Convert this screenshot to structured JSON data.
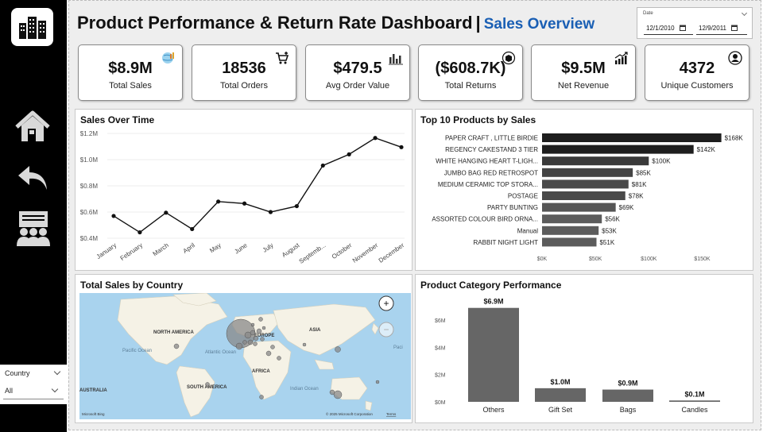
{
  "nav": {
    "logo_icon": "building-icon",
    "items": [
      {
        "icon": "home-icon",
        "name": "home"
      },
      {
        "icon": "back-arrow-icon",
        "name": "back"
      },
      {
        "icon": "team-presentation-icon",
        "name": "customers"
      }
    ]
  },
  "slicer": {
    "title": "Country",
    "value": "All"
  },
  "header": {
    "title": "Product Performance & Return Rate Dashboard",
    "separator": "|",
    "subtitle": "Sales Overview"
  },
  "date_filter": {
    "label": "Date",
    "start": "12/1/2010",
    "end": "12/9/2011"
  },
  "kpis": [
    {
      "value": "$8.9M",
      "label": "Total Sales",
      "icon": "globe-chart-icon"
    },
    {
      "value": "18536",
      "label": "Total Orders",
      "icon": "shopping-cart-icon"
    },
    {
      "value": "$479.5",
      "label": "Avg Order Value",
      "icon": "bar-chart-icon"
    },
    {
      "value": "($608.7K)",
      "label": "Total Returns",
      "icon": "return-box-icon"
    },
    {
      "value": "$9.5M",
      "label": "Net Revenue",
      "icon": "growth-chart-icon"
    },
    {
      "value": "4372",
      "label": "Unique Customers",
      "icon": "user-circle-icon"
    }
  ],
  "sales_over_time": {
    "title": "Sales Over Time"
  },
  "top_products": {
    "title": "Top 10 Products by Sales"
  },
  "country_map": {
    "title": "Total Sales by Country",
    "labels": [
      "NORTH AMERICA",
      "EUROPE",
      "ASIA",
      "AFRICA",
      "SOUTH AMERICA",
      "AUSTRALIA",
      "Pacific Ocean",
      "Atlantic Ocean",
      "Indian Ocean"
    ],
    "attribution": "© 2025 Microsoft Corporation",
    "terms": "Terms",
    "bing": "Microsoft Bing",
    "zoom_in": "+",
    "zoom_out": "−"
  },
  "category_perf": {
    "title": "Product Category Performance"
  },
  "chart_data": [
    {
      "type": "line",
      "title": "Sales Over Time",
      "categories": [
        "January",
        "February",
        "March",
        "April",
        "May",
        "June",
        "July",
        "August",
        "Septemb...",
        "October",
        "November",
        "December"
      ],
      "values": [
        570000,
        445000,
        595000,
        470000,
        680000,
        665000,
        600000,
        645000,
        955000,
        1040000,
        1165000,
        1095000
      ],
      "yticks": [
        "$0.4M",
        "$0.6M",
        "$0.8M",
        "$1.0M",
        "$1.2M"
      ],
      "ylim": [
        400000,
        1200000
      ],
      "grid": true
    },
    {
      "type": "bar",
      "orientation": "horizontal",
      "title": "Top 10 Products by Sales",
      "categories": [
        "PAPER CRAFT , LITTLE BIRDIE",
        "REGENCY CAKESTAND 3 TIER",
        "WHITE HANGING HEART T-LIGH...",
        "JUMBO BAG RED RETROSPOT",
        "MEDIUM CERAMIC TOP STORA...",
        "POSTAGE",
        "PARTY BUNTING",
        "ASSORTED COLOUR BIRD ORNA...",
        "Manual",
        "RABBIT NIGHT LIGHT"
      ],
      "values": [
        168000,
        142000,
        100000,
        85000,
        81000,
        78000,
        69000,
        56000,
        53000,
        51000
      ],
      "data_labels": [
        "$168K",
        "$142K",
        "$100K",
        "$85K",
        "$81K",
        "$78K",
        "$69K",
        "$56K",
        "$53K",
        "$51K"
      ],
      "xticks": [
        "$0K",
        "$50K",
        "$100K",
        "$150K"
      ],
      "xlim": [
        0,
        175000
      ],
      "colors": [
        "#1e1e1e",
        "#1e1e1e",
        "#3a3a3a",
        "#444444",
        "#4a4a4a",
        "#4a4a4a",
        "#555555",
        "#5c5c5c",
        "#5c5c5c",
        "#5c5c5c"
      ]
    },
    {
      "type": "bar",
      "title": "Product Category Performance",
      "categories": [
        "Others",
        "Gift Set",
        "Bags",
        "Candles"
      ],
      "values": [
        6900000,
        1000000,
        900000,
        100000
      ],
      "data_labels": [
        "$6.9M",
        "$1.0M",
        "$0.9M",
        "$0.1M"
      ],
      "yticks": [
        "$0M",
        "$2M",
        "$4M",
        "$6M"
      ],
      "ylim": [
        0,
        7000000
      ],
      "color": "#666666"
    }
  ]
}
